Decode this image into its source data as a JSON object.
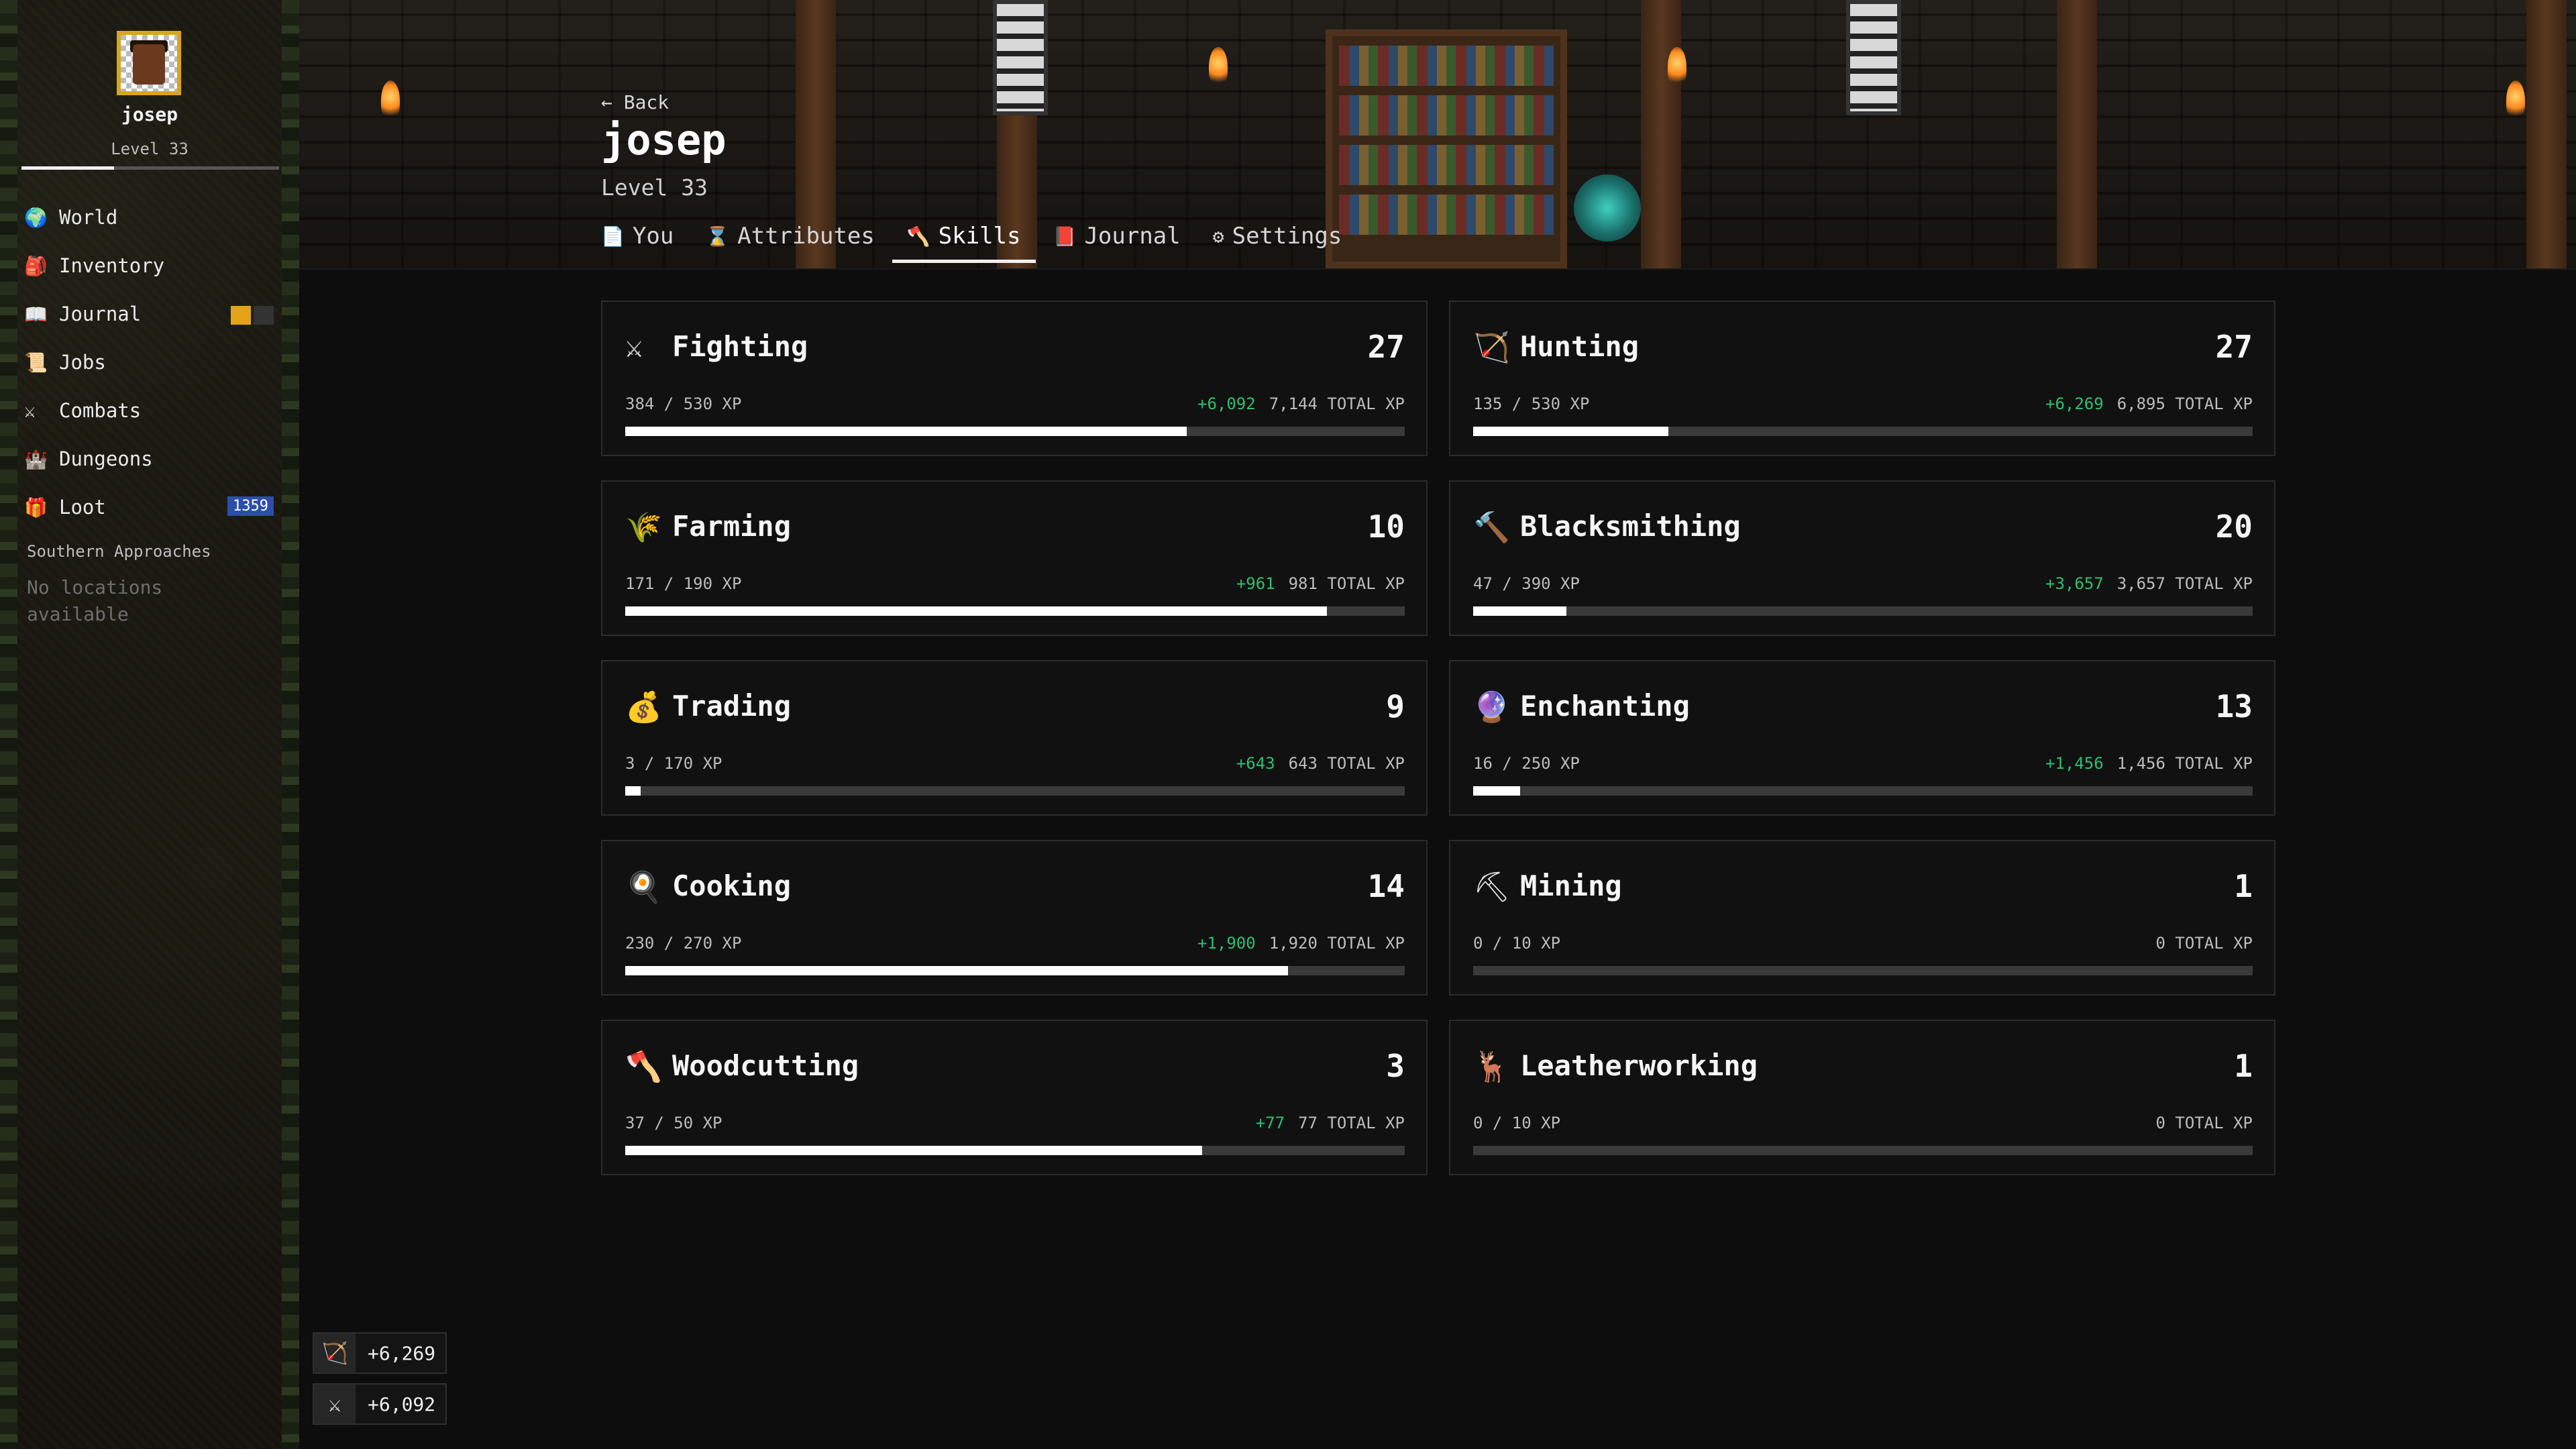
{
  "player": {
    "name": "josep",
    "level_label": "Level 33",
    "xp_progress": 0.36
  },
  "sidebar": {
    "items": [
      {
        "id": "world",
        "label": "World",
        "icon": "globe-icon",
        "glyph": "🌍"
      },
      {
        "id": "inventory",
        "label": "Inventory",
        "icon": "backpack-icon",
        "glyph": "🎒"
      },
      {
        "id": "journal",
        "label": "Journal",
        "icon": "book-icon",
        "glyph": "📖"
      },
      {
        "id": "jobs",
        "label": "Jobs",
        "icon": "scroll-icon",
        "glyph": "📜"
      },
      {
        "id": "combats",
        "label": "Combats",
        "icon": "crossed-swords-icon",
        "glyph": "⚔"
      },
      {
        "id": "dungeons",
        "label": "Dungeons",
        "icon": "dungeon-icon",
        "glyph": "🏰"
      },
      {
        "id": "loot",
        "label": "Loot",
        "icon": "treasure-icon",
        "glyph": "🎁",
        "badge": "1359"
      }
    ],
    "region": "Southern Approaches",
    "no_locations": "No locations available"
  },
  "header": {
    "back_label": "← Back",
    "title": "josep",
    "subtitle": "Level 33",
    "tabs": [
      {
        "id": "you",
        "label": "You",
        "icon": "document-icon",
        "glyph": "📄",
        "active": false
      },
      {
        "id": "attributes",
        "label": "Attributes",
        "icon": "hourglass-icon",
        "glyph": "⌛",
        "active": false
      },
      {
        "id": "skills",
        "label": "Skills",
        "icon": "axe-icon",
        "glyph": "🪓",
        "active": true
      },
      {
        "id": "journal",
        "label": "Journal",
        "icon": "book-icon",
        "glyph": "📕",
        "active": false
      },
      {
        "id": "settings",
        "label": "Settings",
        "icon": "gear-icon",
        "glyph": "⚙",
        "active": false
      }
    ]
  },
  "skills": [
    {
      "name": "Fighting",
      "icon": "crossed-swords-icon",
      "glyph": "⚔",
      "level": "27",
      "xp": "384 / 530 XP",
      "gain": "+6,092",
      "total": "7,144 TOTAL XP",
      "progress": 0.72
    },
    {
      "name": "Hunting",
      "icon": "bow-icon",
      "glyph": "🏹",
      "level": "27",
      "xp": "135 / 530 XP",
      "gain": "+6,269",
      "total": "6,895 TOTAL XP",
      "progress": 0.25
    },
    {
      "name": "Farming",
      "icon": "wheat-icon",
      "glyph": "🌾",
      "level": "10",
      "xp": "171 / 190 XP",
      "gain": "+961",
      "total": "981 TOTAL XP",
      "progress": 0.9
    },
    {
      "name": "Blacksmithing",
      "icon": "hammer-icon",
      "glyph": "🔨",
      "level": "20",
      "xp": "47 / 390 XP",
      "gain": "+3,657",
      "total": "3,657 TOTAL XP",
      "progress": 0.12
    },
    {
      "name": "Trading",
      "icon": "money-bag-icon",
      "glyph": "💰",
      "level": "9",
      "xp": "3 / 170 XP",
      "gain": "+643",
      "total": "643 TOTAL XP",
      "progress": 0.02
    },
    {
      "name": "Enchanting",
      "icon": "crystal-ball-icon",
      "glyph": "🔮",
      "level": "13",
      "xp": "16 / 250 XP",
      "gain": "+1,456",
      "total": "1,456 TOTAL XP",
      "progress": 0.06
    },
    {
      "name": "Cooking",
      "icon": "frying-pan-icon",
      "glyph": "🍳",
      "level": "14",
      "xp": "230 / 270 XP",
      "gain": "+1,900",
      "total": "1,920 TOTAL XP",
      "progress": 0.85
    },
    {
      "name": "Mining",
      "icon": "pickaxe-icon",
      "glyph": "⛏",
      "level": "1",
      "xp": "0 / 10 XP",
      "gain": "",
      "total": "0 TOTAL XP",
      "progress": 0
    },
    {
      "name": "Woodcutting",
      "icon": "axe-icon",
      "glyph": "🪓",
      "level": "3",
      "xp": "37 / 50 XP",
      "gain": "+77",
      "total": "77 TOTAL XP",
      "progress": 0.74
    },
    {
      "name": "Leatherworking",
      "icon": "deer-icon",
      "glyph": "🦌",
      "level": "1",
      "xp": "0 / 10 XP",
      "gain": "",
      "total": "0 TOTAL XP",
      "progress": 0
    }
  ],
  "toasts": [
    {
      "icon": "bow-icon",
      "glyph": "🏹",
      "value": "+6,269"
    },
    {
      "icon": "crossed-swords-icon",
      "glyph": "⚔",
      "value": "+6,092"
    }
  ]
}
